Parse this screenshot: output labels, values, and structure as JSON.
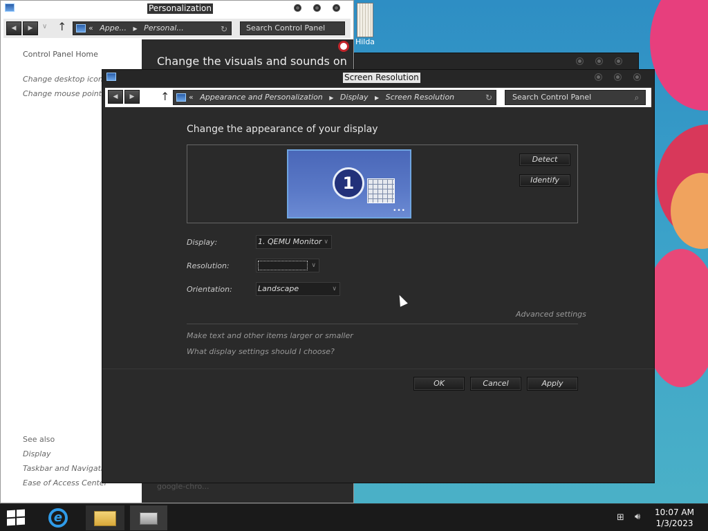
{
  "desktop": {
    "icon_label": "Hilda"
  },
  "personalization": {
    "title": "Personalization",
    "address": {
      "crumbs": [
        "Appe...",
        "Personal..."
      ]
    },
    "search_placeholder": "Search Control Panel",
    "sidebar": {
      "top_links": [
        "Control Panel Home",
        "Change desktop icons",
        "Change mouse pointers"
      ],
      "see_also_label": "See also",
      "see_also_links": [
        "Display",
        "Taskbar and Navigation",
        "Ease of Access Center"
      ]
    },
    "heading": "Change the visuals and sounds on",
    "faded_item": "google-chro..."
  },
  "screen_resolution": {
    "title": "Screen Resolution",
    "address": {
      "crumbs": [
        "Appearance and Personalization",
        "Display",
        "Screen Resolution"
      ]
    },
    "search_placeholder": "Search Control Panel",
    "heading": "Change the appearance of your display",
    "monitor_number": "1",
    "detect_button": "Detect",
    "identify_button": "Identify",
    "display": {
      "label": "Display:",
      "value": "1. QEMU Monitor"
    },
    "resolution": {
      "label": "Resolution:",
      "value": ""
    },
    "orientation": {
      "label": "Orientation:",
      "value": "Landscape"
    },
    "advanced_settings": "Advanced settings",
    "link_text_size": "Make text and other items larger or smaller",
    "link_help": "What display settings should I choose?",
    "ok_button": "OK",
    "cancel_button": "Cancel",
    "apply_button": "Apply"
  },
  "taskbar": {
    "time": "10:07 AM",
    "date": "1/3/2023"
  },
  "colors": {
    "desktop_bg": "#3ba2c9",
    "window_dark": "#2a2a2a",
    "monitor_blue": "#5a79c7"
  }
}
